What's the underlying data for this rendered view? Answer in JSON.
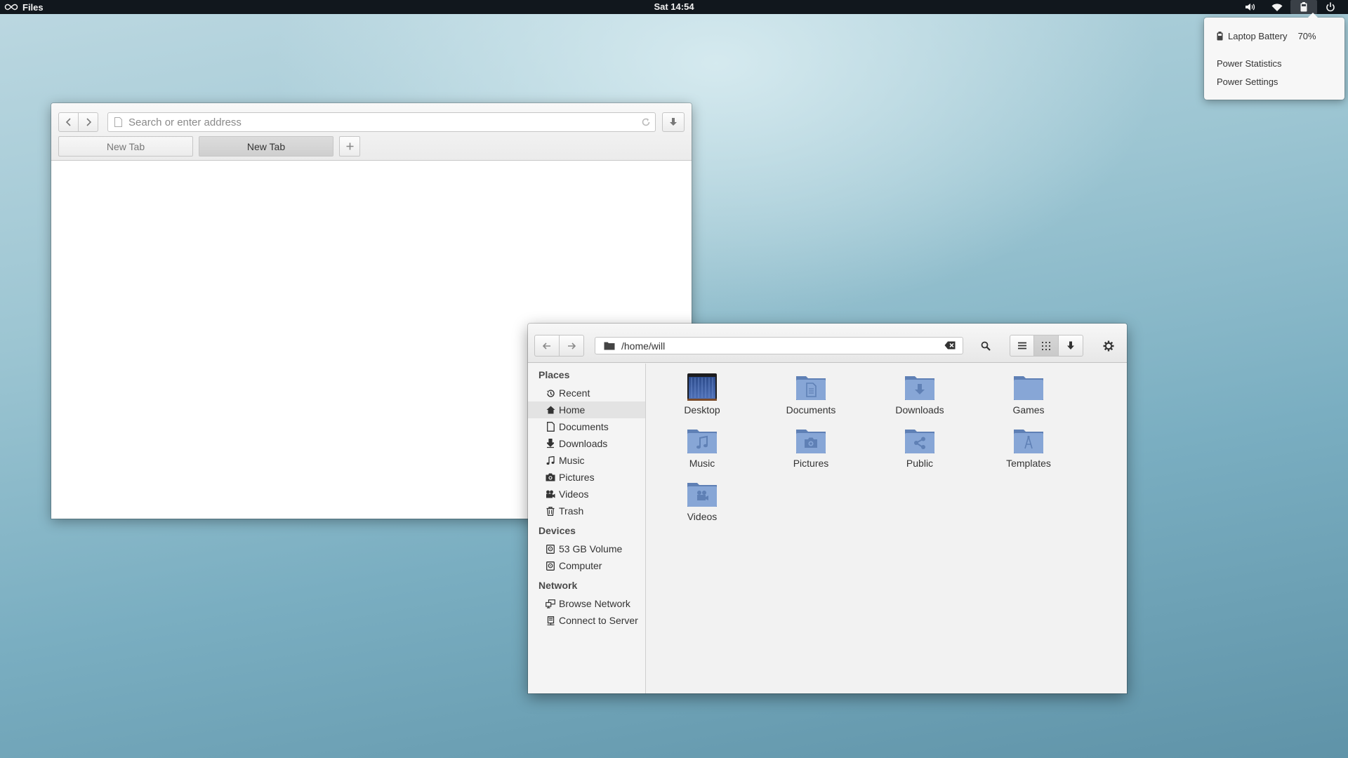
{
  "panel": {
    "app_name": "Files",
    "clock": "Sat 14:54",
    "indicators": [
      {
        "icon": "volume-icon"
      },
      {
        "icon": "wifi-icon"
      },
      {
        "icon": "battery-icon",
        "active": true
      },
      {
        "icon": "power-icon"
      }
    ]
  },
  "power_menu": {
    "battery_label": "Laptop Battery",
    "battery_percent": "70%",
    "battery_level": 0.7,
    "items": [
      "Power Statistics",
      "Power Settings"
    ]
  },
  "browser": {
    "address_placeholder": "Search or enter address",
    "tabs": [
      {
        "label": "New Tab",
        "active": false
      },
      {
        "label": "New Tab",
        "active": true
      }
    ]
  },
  "files": {
    "path": "/home/will",
    "view_mode": "grid",
    "sidebar": {
      "places_heading": "Places",
      "places": [
        {
          "label": "Recent",
          "icon": "recent-icon"
        },
        {
          "label": "Home",
          "icon": "home-icon",
          "selected": true
        },
        {
          "label": "Documents",
          "icon": "document-icon"
        },
        {
          "label": "Downloads",
          "icon": "download-icon"
        },
        {
          "label": "Music",
          "icon": "music-icon"
        },
        {
          "label": "Pictures",
          "icon": "camera-icon"
        },
        {
          "label": "Videos",
          "icon": "video-icon"
        },
        {
          "label": "Trash",
          "icon": "trash-icon"
        }
      ],
      "devices_heading": "Devices",
      "devices": [
        {
          "label": "53 GB Volume",
          "icon": "drive-icon"
        },
        {
          "label": "Computer",
          "icon": "drive-icon"
        }
      ],
      "network_heading": "Network",
      "network": [
        {
          "label": "Browse Network",
          "icon": "network-icon"
        },
        {
          "label": "Connect to Server",
          "icon": "server-icon"
        }
      ]
    },
    "items": [
      {
        "label": "Desktop",
        "type": "desktop"
      },
      {
        "label": "Documents",
        "type": "documents"
      },
      {
        "label": "Downloads",
        "type": "downloads"
      },
      {
        "label": "Games",
        "type": "games"
      },
      {
        "label": "Music",
        "type": "music"
      },
      {
        "label": "Pictures",
        "type": "pictures"
      },
      {
        "label": "Public",
        "type": "public"
      },
      {
        "label": "Templates",
        "type": "templates"
      },
      {
        "label": "Videos",
        "type": "videos"
      }
    ]
  },
  "colors": {
    "panel_bg": "#11171d",
    "folder_blue": "#7f9fcf",
    "folder_blue_dark": "#5f80b5"
  }
}
